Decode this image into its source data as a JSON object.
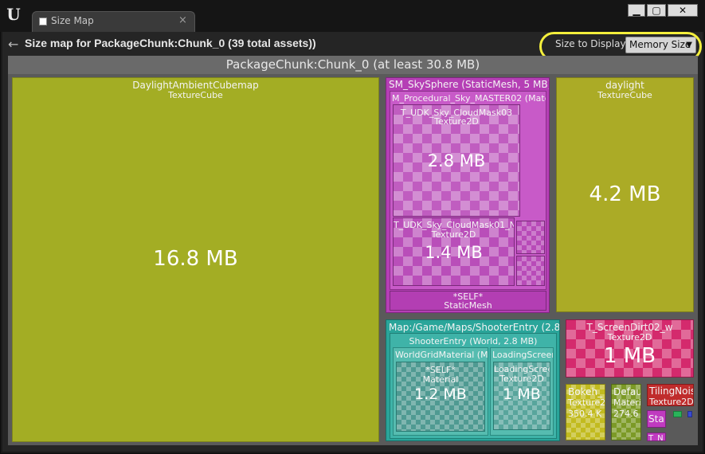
{
  "window": {
    "tab_title": "Size Map",
    "tab_close": "×",
    "minimize": "▁",
    "maximize": "▢",
    "close": "✕",
    "logo": "U"
  },
  "header": {
    "back_icon": "←",
    "title": "Size map for PackageChunk:Chunk_0  (39 total assets))",
    "size_to_display_label": "Size to Display:",
    "size_to_display_value": "Memory Size",
    "dropdown_caret": "▼"
  },
  "map": {
    "root_title": "PackageChunk:Chunk_0  (at least 30.8 MB)",
    "cells": {
      "daylight_ambient": {
        "title": "DaylightAmbientCubemap",
        "type": "TextureCube",
        "size": "16.8 MB",
        "color": "#a3ad24"
      },
      "skysphere": {
        "title": "SM_SkySphere  (StaticMesh, 5 MB)",
        "color": "#b53fb5"
      },
      "procedural_sky": {
        "title": "M_Procedural_Sky_MASTER02  (Material"
      },
      "cloudmask03": {
        "title": "T_UDK_Sky_CloudMask03",
        "type": "Texture2D",
        "size": "2.8 MB"
      },
      "cloudmask01": {
        "title": "T_UDK_Sky_CloudMask01_N",
        "type": "Texture2D",
        "size": "1.4 MB"
      },
      "sky_self": {
        "title": "*SELF*",
        "type": "StaticMesh"
      },
      "daylight": {
        "title": "daylight",
        "type": "TextureCube",
        "size": "4.2 MB",
        "color": "#abab26"
      },
      "shooter_map": {
        "title": "Map:/Game/Maps/ShooterEntry  (2.8",
        "color": "#2aa59a"
      },
      "shooter_entry": {
        "title": "ShooterEntry  (World, 2.8 MB)"
      },
      "worldgrid": {
        "title": "WorldGridMaterial  (Mat"
      },
      "worldgrid_self": {
        "title": "*SELF*",
        "type": "Material",
        "size": "1.2 MB"
      },
      "loading_screen_parent": {
        "title": "LoadingScreen"
      },
      "loading_screen": {
        "title": "LoadingScree",
        "type": "Texture2D",
        "size": "1 MB"
      },
      "screendirt": {
        "title": "T_ScreenDirt02_w",
        "type": "Texture2D",
        "size": "1 MB",
        "color": "#d42a6d"
      },
      "bokeh": {
        "title": "Bokeh_",
        "type": "Texture2",
        "size": "350.4 K",
        "color": "#c2bb1f"
      },
      "default": {
        "title": "Defau",
        "type": "Materi",
        "size": "274.6",
        "color": "#7c9a26"
      },
      "tilingnoise": {
        "title": "TilingNois",
        "type": "Texture2D",
        "color": "#c02c2c"
      },
      "sta": {
        "title": "Sta",
        "color": "#c03ac0"
      },
      "t_n": {
        "title": "T_N"
      }
    }
  }
}
